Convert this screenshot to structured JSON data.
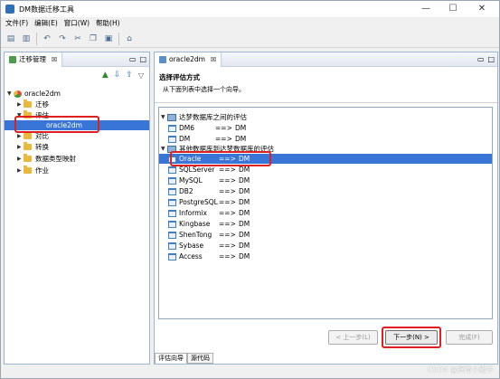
{
  "window": {
    "title": "DM数据迁移工具",
    "minimize": "—",
    "maximize": "☐",
    "close": "✕"
  },
  "menu": {
    "file": "文件(F)",
    "edit": "编辑(E)",
    "window": "窗口(W)",
    "help": "帮助(H)"
  },
  "left_panel": {
    "tab_label": "迁移管理",
    "tab_suffix": "☒",
    "tree": {
      "root": "oracle2dm",
      "items": [
        "迁移",
        "评估",
        "oracle2dm",
        "对比",
        "转换",
        "数据类型映射",
        "作业"
      ]
    }
  },
  "right_panel": {
    "tab_label": "oracle2dm",
    "tab_suffix": "☒",
    "wizard_title": "选择评估方式",
    "wizard_desc": "从下面列表中选择一个向导。",
    "group1": "达梦数据库之间的评估",
    "group1_items": [
      {
        "src": "DM6",
        "arrow": "==>",
        "dst": "DM"
      },
      {
        "src": "DM",
        "arrow": "==>",
        "dst": "DM"
      }
    ],
    "group2": "其他数据库到达梦数据库的评估",
    "group2_items": [
      {
        "src": "Oracle",
        "arrow": "==>",
        "dst": "DM"
      },
      {
        "src": "SQLServer",
        "arrow": "==>",
        "dst": "DM"
      },
      {
        "src": "MySQL",
        "arrow": "==>",
        "dst": "DM"
      },
      {
        "src": "DB2",
        "arrow": "==>",
        "dst": "DM"
      },
      {
        "src": "PostgreSQL",
        "arrow": "==>",
        "dst": "DM"
      },
      {
        "src": "Informix",
        "arrow": "==>",
        "dst": "DM"
      },
      {
        "src": "Kingbase",
        "arrow": "==>",
        "dst": "DM"
      },
      {
        "src": "ShenTong",
        "arrow": "==>",
        "dst": "DM"
      },
      {
        "src": "Sybase",
        "arrow": "==>",
        "dst": "DM"
      },
      {
        "src": "Access",
        "arrow": "==>",
        "dst": "DM"
      }
    ],
    "selected": "Oracle",
    "buttons": {
      "back": "< 上一步(L)",
      "next": "下一步(N) >",
      "finish": "完成(F)"
    },
    "bottom_tabs": [
      "评估向导",
      "源代码"
    ]
  },
  "watermark": "CSDN @摇背小能手",
  "colors": {
    "selection": "#3875d7",
    "highlight_box": "#e02020"
  }
}
